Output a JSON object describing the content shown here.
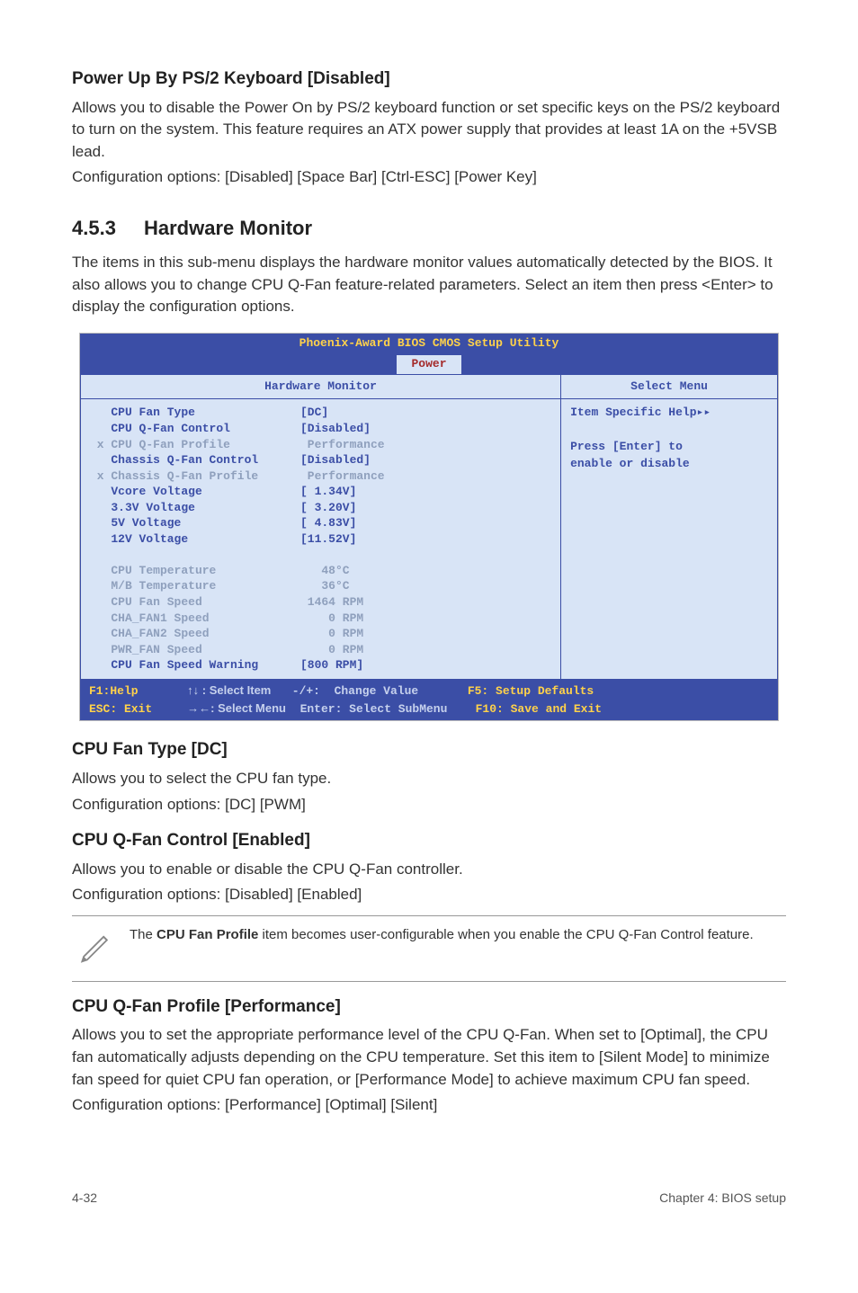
{
  "h1": "Power Up By PS/2 Keyboard [Disabled]",
  "p1": "Allows you to disable the Power On by PS/2 keyboard function or set specific keys on the PS/2 keyboard to turn on the system. This feature requires an ATX power supply that provides at least 1A on the +5VSB lead.",
  "p1b": "Configuration options: [Disabled] [Space Bar] [Ctrl-ESC] [Power Key]",
  "sec_num": "4.5.3",
  "sec_title": "Hardware Monitor",
  "p2": "The items in this sub-menu displays the hardware monitor values automatically detected by the BIOS. It also allows you to change CPU Q-Fan feature-related parameters. Select an item then press <Enter> to display the configuration options.",
  "bios": {
    "title": "Phoenix-Award BIOS CMOS Setup Utility",
    "tab": "Power",
    "header_left": "Hardware Monitor",
    "header_right": "Select Menu",
    "help_title": "Item Specific Help▸▸",
    "help_body1": "Press [Enter] to",
    "help_body2": "enable or disable",
    "rows": [
      {
        "l": "   CPU Fan Type",
        "v": "[DC]",
        "g": false
      },
      {
        "l": "   CPU Q-Fan Control",
        "v": "[Disabled]",
        "g": false
      },
      {
        "l": " x CPU Q-Fan Profile",
        "v": " Performance",
        "g": true
      },
      {
        "l": "   Chassis Q-Fan Control",
        "v": "[Disabled]",
        "g": false
      },
      {
        "l": " x Chassis Q-Fan Profile",
        "v": " Performance",
        "g": true
      },
      {
        "l": "   Vcore Voltage",
        "v": "[ 1.34V]",
        "g": false
      },
      {
        "l": "   3.3V Voltage",
        "v": "[ 3.20V]",
        "g": false
      },
      {
        "l": "   5V Voltage",
        "v": "[ 4.83V]",
        "g": false
      },
      {
        "l": "   12V Voltage",
        "v": "[11.52V]",
        "g": false
      },
      {
        "l": "",
        "v": "",
        "g": false
      },
      {
        "l": "   CPU Temperature",
        "v": "   48°C",
        "g": true
      },
      {
        "l": "   M/B Temperature",
        "v": "   36°C",
        "g": true
      },
      {
        "l": "   CPU Fan Speed",
        "v": " 1464 RPM",
        "g": true
      },
      {
        "l": "   CHA_FAN1 Speed",
        "v": "    0 RPM",
        "g": true
      },
      {
        "l": "   CHA_FAN2 Speed",
        "v": "    0 RPM",
        "g": true
      },
      {
        "l": "   PWR_FAN Speed",
        "v": "    0 RPM",
        "g": true
      },
      {
        "l": "   CPU Fan Speed Warning",
        "v": "[800 RPM]",
        "g": false
      }
    ],
    "footer_f1": "F1:Help",
    "footer_select_item": "↑↓ : Select Item",
    "footer_change": "-/+:  Change Value",
    "footer_f5": "F5: Setup Defaults",
    "footer_esc": "ESC: Exit",
    "footer_select_menu": "→←: Select Menu",
    "footer_enter": "Enter: Select SubMenu",
    "footer_f10": "F10: Save and Exit"
  },
  "h2": "CPU Fan Type [DC]",
  "p3": "Allows you to select the CPU fan type.",
  "p3b": "Configuration options: [DC] [PWM]",
  "h3": "CPU Q-Fan Control [Enabled]",
  "p4": "Allows you to enable or disable the CPU Q-Fan controller.",
  "p4b": "Configuration options: [Disabled] [Enabled]",
  "note_prefix": "The ",
  "note_bold": "CPU Fan Profile",
  "note_suffix": " item becomes user-configurable when you enable the CPU Q-Fan Control feature.",
  "h4": "CPU Q-Fan Profile [Performance]",
  "p5": "Allows you to set the appropriate performance level of the CPU Q-Fan. When set to [Optimal], the CPU fan automatically adjusts depending on the CPU temperature. Set this item to [Silent Mode] to minimize fan speed for quiet CPU fan operation, or [Performance Mode] to achieve maximum CPU fan speed.",
  "p5b": "Configuration options: [Performance] [Optimal] [Silent]",
  "footer_left": "4-32",
  "footer_right": "Chapter 4: BIOS setup"
}
